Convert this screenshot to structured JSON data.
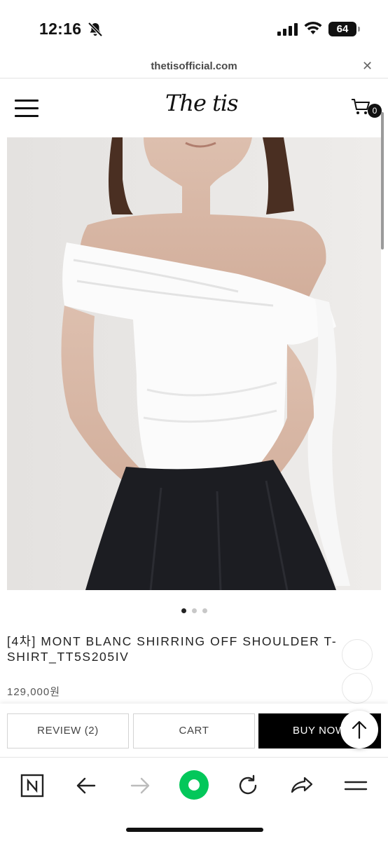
{
  "status_bar": {
    "time": "12:16",
    "battery": "64",
    "icons": [
      "bell-slash-icon",
      "signal-icon",
      "wifi-icon",
      "battery-icon"
    ]
  },
  "browser": {
    "url": "thetisofficial.com",
    "close_icon": "close-icon"
  },
  "header": {
    "logo": "The tis",
    "cart_count": "0"
  },
  "product": {
    "image_alt": "product-photo",
    "carousel": {
      "total": 3,
      "active": 1
    },
    "title": "[4차] MONT BLANC SHIRRING OFF SHOULDER T-SHIRT_TT5S205IV",
    "price": "129,000원"
  },
  "actions": {
    "review_label": "REVIEW (2)",
    "cart_label": "CART",
    "buy_label": "BUY NOW"
  },
  "toolbar": {
    "items": [
      "naver-icon",
      "back-icon",
      "forward-icon",
      "green-home-icon",
      "reload-icon",
      "share-icon",
      "menu-icon"
    ]
  },
  "colors": {
    "accent_green": "#03c75a",
    "buy_button": "#000000"
  }
}
